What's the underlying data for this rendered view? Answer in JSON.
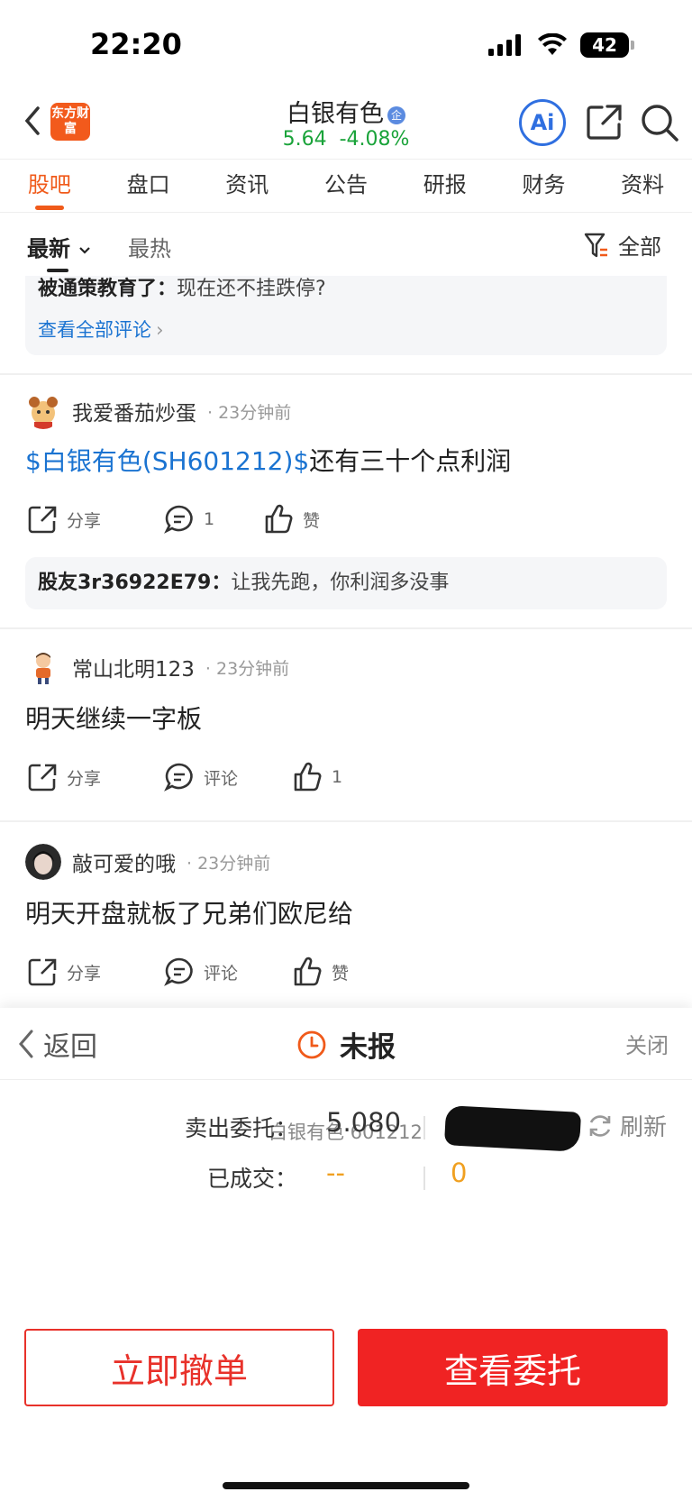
{
  "status_bar": {
    "time": "22:20",
    "battery": "42"
  },
  "header": {
    "app_logo_text": "东方财富",
    "stock_name": "白银有色",
    "badge": "企",
    "price": "5.64",
    "change": "-4.08%",
    "ai_label": "Ai"
  },
  "tabs": [
    {
      "label": "股吧",
      "active": true
    },
    {
      "label": "盘口"
    },
    {
      "label": "资讯"
    },
    {
      "label": "公告"
    },
    {
      "label": "研报"
    },
    {
      "label": "财务"
    },
    {
      "label": "资料"
    }
  ],
  "sort": {
    "newest": "最新",
    "hottest": "最热",
    "filter_label": "全部"
  },
  "feed": {
    "top_reply": {
      "user": "被通策教育了：",
      "text": "现在还不挂跌停?",
      "view_all": "查看全部评论"
    },
    "posts": [
      {
        "user": "我爱番茄炒蛋",
        "time": "· 23分钟前",
        "stock_link": "$白银有色(SH601212)$",
        "text": "还有三十个点利润",
        "share": "分享",
        "comment": "1",
        "like": "赞",
        "reply": {
          "user": "股友3r36922E79：",
          "text": "让我先跑，你利润多没事"
        }
      },
      {
        "user": "常山北明123",
        "time": "· 23分钟前",
        "text": "明天继续一字板",
        "share": "分享",
        "comment": "评论",
        "like": "1"
      },
      {
        "user": "敲可爱的哦",
        "time": "· 23分钟前",
        "text": "明天开盘就板了兄弟们欧尼给",
        "share": "分享",
        "comment": "评论",
        "like": "赞"
      }
    ]
  },
  "order_sheet": {
    "back": "返回",
    "status": "未报",
    "close": "关闭",
    "stock": "白银有色 601212",
    "refresh": "刷新",
    "sell_label": "卖出委托：",
    "sell_price": "5.080",
    "filled_label": "已成交：",
    "filled_price": "--",
    "filled_qty": "0",
    "cancel_button": "立即撤单",
    "view_button": "查看委托"
  },
  "colors": {
    "accent": "#f05a1a",
    "up_green": "#1aa33a",
    "link_blue": "#1a73d1",
    "sell_red": "#f02323",
    "filled_orange": "#f0a020"
  }
}
